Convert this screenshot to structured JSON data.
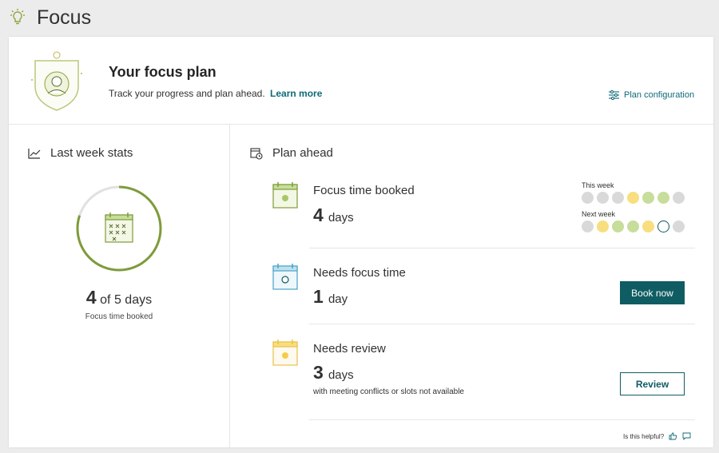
{
  "page": {
    "title": "Focus"
  },
  "plan": {
    "heading": "Your focus plan",
    "subtitle": "Track your progress and plan ahead.",
    "learn_more": "Learn more",
    "configuration_label": "Plan configuration"
  },
  "last_week": {
    "title": "Last week stats",
    "booked": "4",
    "of_text": "of 5 days",
    "caption": "Focus time booked",
    "progress_fraction": 0.8
  },
  "plan_ahead": {
    "title": "Plan ahead",
    "rows": [
      {
        "title": "Focus time booked",
        "value": "4",
        "unit": "days"
      },
      {
        "title": "Needs focus time",
        "value": "1",
        "unit": "day",
        "button": "Book now"
      },
      {
        "title": "Needs review",
        "value": "3",
        "unit": "days",
        "note": "with meeting conflicts or slots not available",
        "button": "Review"
      }
    ],
    "this_week_label": "This week",
    "next_week_label": "Next week",
    "this_week_days": [
      "empty",
      "empty",
      "empty",
      "needs-review",
      "booked",
      "booked",
      "empty"
    ],
    "next_week_days": [
      "empty",
      "needs-review",
      "booked",
      "booked",
      "needs-review",
      "needs-focus",
      "empty"
    ]
  },
  "colors": {
    "empty": "#d9d9d9",
    "booked": "#c7dd9b",
    "needs-review": "#f8de7e",
    "needs-focus": "#ffffff",
    "needs-focus-border": "#0f5c63",
    "accent": "#0f5c63",
    "ring": "#7f9b3a"
  },
  "feedback": {
    "label": "Is this helpful?"
  }
}
